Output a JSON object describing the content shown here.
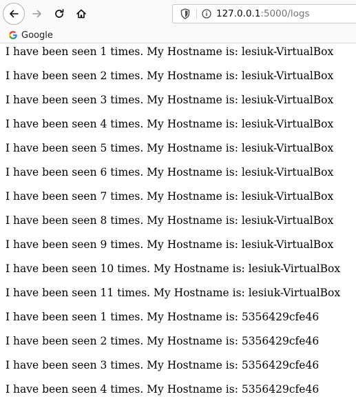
{
  "browser": {
    "url_host": "127.0.0.1",
    "url_path": ":5000/logs",
    "icons": {
      "back": "back-arrow-icon",
      "forward": "forward-arrow-icon",
      "reload": "reload-icon",
      "home": "home-icon",
      "shield": "shield-icon",
      "info": "info-icon",
      "google": "google-icon"
    }
  },
  "bookmarks": {
    "items": [
      {
        "label": "Google"
      }
    ]
  },
  "logs": [
    "I have been seen 1 times. My Hostname is: lesiuk-VirtualBox",
    "I have been seen 2 times. My Hostname is: lesiuk-VirtualBox",
    "I have been seen 3 times. My Hostname is: lesiuk-VirtualBox",
    "I have been seen 4 times. My Hostname is: lesiuk-VirtualBox",
    "I have been seen 5 times. My Hostname is: lesiuk-VirtualBox",
    "I have been seen 6 times. My Hostname is: lesiuk-VirtualBox",
    "I have been seen 7 times. My Hostname is: lesiuk-VirtualBox",
    "I have been seen 8 times. My Hostname is: lesiuk-VirtualBox",
    "I have been seen 9 times. My Hostname is: lesiuk-VirtualBox",
    "I have been seen 10 times. My Hostname is: lesiuk-VirtualBox",
    "I have been seen 11 times. My Hostname is: lesiuk-VirtualBox",
    "I have been seen 1 times. My Hostname is: 5356429cfe46",
    "I have been seen 2 times. My Hostname is: 5356429cfe46",
    "I have been seen 3 times. My Hostname is: 5356429cfe46",
    "I have been seen 4 times. My Hostname is: 5356429cfe46"
  ]
}
